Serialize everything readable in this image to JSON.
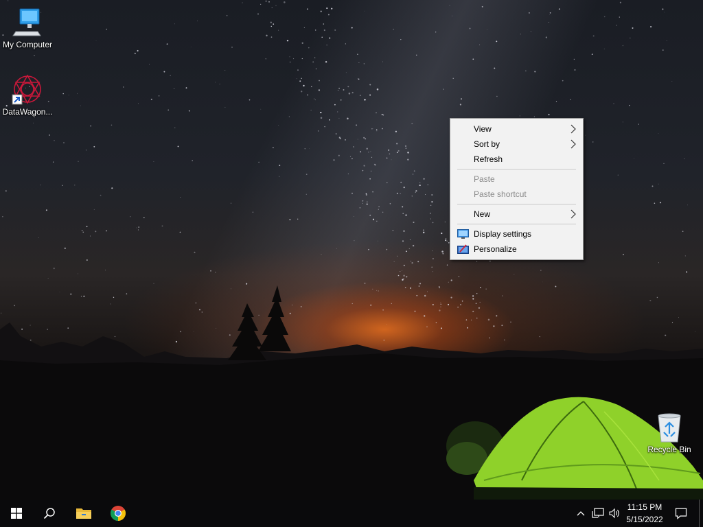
{
  "desktop": {
    "icons": [
      {
        "label": "My Computer",
        "icon": "computer-icon"
      },
      {
        "label": "DataWagon...",
        "icon": "datawagon-shortcut-icon"
      },
      {
        "label": "Recycle Bin",
        "icon": "recycle-bin-icon"
      }
    ]
  },
  "context_menu": {
    "items": [
      {
        "label": "View",
        "has_submenu": true,
        "enabled": true
      },
      {
        "label": "Sort by",
        "has_submenu": true,
        "enabled": true
      },
      {
        "label": "Refresh",
        "enabled": true
      },
      {
        "label": "Paste",
        "enabled": false
      },
      {
        "label": "Paste shortcut",
        "enabled": false
      },
      {
        "label": "New",
        "has_submenu": true,
        "enabled": true
      },
      {
        "label": "Display settings",
        "icon": "display-settings-icon",
        "enabled": true
      },
      {
        "label": "Personalize",
        "icon": "personalize-icon",
        "enabled": true
      }
    ]
  },
  "taskbar": {
    "buttons": [
      {
        "icon": "windows-start-icon"
      },
      {
        "icon": "search-icon"
      },
      {
        "icon": "file-explorer-icon"
      },
      {
        "icon": "chrome-icon"
      }
    ],
    "tray": {
      "icons": [
        "chevron-up-icon",
        "network-icon",
        "volume-icon",
        "notification-icon"
      ],
      "time": "11:15 PM",
      "date": "5/15/2022"
    }
  },
  "colors": {
    "menu_bg": "#f2f2f2",
    "menu_disabled_text": "#8a8a8a",
    "taskbar_bg": "#0a0a0c",
    "tent_green": "#8fd12a"
  }
}
